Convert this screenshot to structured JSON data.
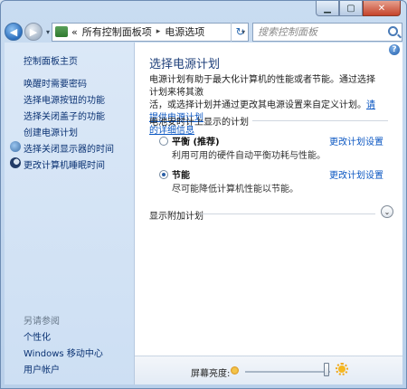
{
  "window": {
    "caption": {
      "minimize": "▁",
      "maximize": "▢",
      "close": "✕"
    }
  },
  "nav": {
    "back_glyph": "◀",
    "forward_glyph": "▶",
    "dropdown_glyph": "▾",
    "address": {
      "overflow": "«",
      "crumbs": [
        "所有控制面板项",
        "电源选项"
      ],
      "separator": "▸",
      "refresh_glyph": "↻"
    },
    "search": {
      "placeholder": "搜索控制面板"
    }
  },
  "sidebar": {
    "items": [
      {
        "label": "控制面板主页"
      },
      {
        "label": "唤醒时需要密码"
      },
      {
        "label": "选择电源按钮的功能"
      },
      {
        "label": "选择关闭盖子的功能"
      },
      {
        "label": "创建电源计划"
      },
      {
        "label": "选择关闭显示器的时间",
        "icon": "monitor-icon"
      },
      {
        "label": "更改计算机睡眠时间",
        "icon": "moon-icon"
      }
    ],
    "see_also_heading": "另请参阅",
    "see_also": [
      {
        "label": "个性化"
      },
      {
        "label": "Windows 移动中心"
      },
      {
        "label": "用户帐户"
      }
    ]
  },
  "main": {
    "help_glyph": "?",
    "title": "选择电源计划",
    "description_line1": "电源计划有助于最大化计算机的性能或者节能。通过选择计划来将其激",
    "description_line2": "活，或选择计划并通过更改其电源设置来自定义计划。",
    "description_link_a": "请提供电源计划",
    "description_link_b": "的详细信息",
    "group_label": "电池安时计上显示的计划",
    "plans": [
      {
        "name": "平衡 (推荐)",
        "description": "利用可用的硬件自动平衡功耗与性能。",
        "selected": false,
        "link": "更改计划设置"
      },
      {
        "name": "节能",
        "description": "尽可能降低计算机性能以节能。",
        "selected": true,
        "link": "更改计划设置"
      }
    ],
    "show_more": "显示附加计划",
    "expand_glyph": "⌄"
  },
  "bottom": {
    "brightness_label": "屏幕亮度:",
    "brightness_level": 0.96
  },
  "colors": {
    "link": "#0a56c2",
    "title": "#1e3f7a",
    "sidebar_link": "#0a3273",
    "close_button": "#c5432a"
  }
}
